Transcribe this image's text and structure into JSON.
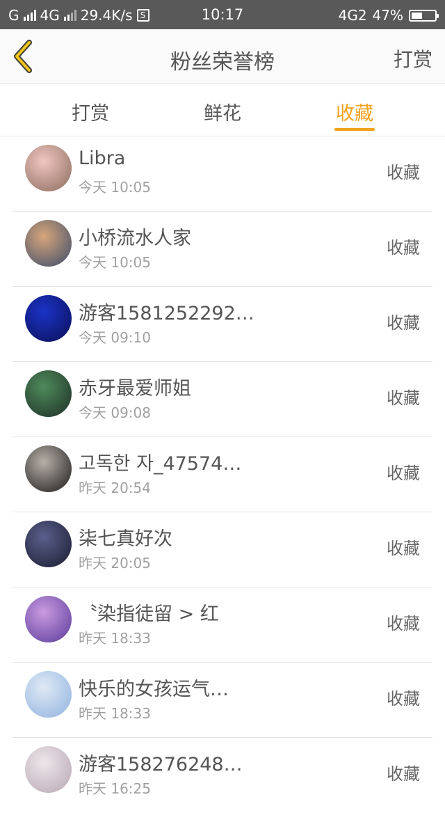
{
  "status_bar": {
    "carrier1": "G",
    "carrier2": "4G",
    "speed": "29.4K/s",
    "s_icon": "S",
    "time": "10:17",
    "network": "4G2",
    "battery": "47%",
    "battery_level": 0.47
  },
  "header": {
    "title": "粉丝荣誉榜",
    "action": "打赏",
    "back_icon": "chevron-left-icon"
  },
  "tabs": [
    {
      "label": "打赏",
      "active": false
    },
    {
      "label": "鲜花",
      "active": false
    },
    {
      "label": "收藏",
      "active": true
    }
  ],
  "accent_color": "#f2a21d",
  "fans": [
    {
      "name": "Libra",
      "time": "今天 10:05",
      "type": "收藏",
      "avatar_colors": [
        "#f1c6c2",
        "#8a6b5a"
      ]
    },
    {
      "name": "小桥流水人家",
      "time": "今天 10:05",
      "type": "收藏",
      "avatar_colors": [
        "#d7a57a",
        "#3a4c6b"
      ]
    },
    {
      "name": "游客1581252292…",
      "time": "今天 09:10",
      "type": "收藏",
      "avatar_colors": [
        "#1c33c8",
        "#0a0f55"
      ]
    },
    {
      "name": "赤牙最爱师姐",
      "time": "今天 09:08",
      "type": "收藏",
      "avatar_colors": [
        "#4f8a5a",
        "#1d2e26"
      ]
    },
    {
      "name": "고독한 자_47574…",
      "time": "昨天 20:54",
      "type": "收藏",
      "avatar_colors": [
        "#b8b0a8",
        "#1b1919"
      ]
    },
    {
      "name": "柒七真好次",
      "time": "昨天 20:05",
      "type": "收藏",
      "avatar_colors": [
        "#5a5f8c",
        "#1a1c2e"
      ]
    },
    {
      "name": "〝染指徒留 > 红",
      "time": "昨天 18:33",
      "type": "收藏",
      "avatar_colors": [
        "#c99be0",
        "#5a3a9a"
      ]
    },
    {
      "name": "快乐的女孩运气…",
      "time": "昨天 18:33",
      "type": "收藏",
      "avatar_colors": [
        "#dfe9f5",
        "#8fb2de"
      ]
    },
    {
      "name": "游客158276248…",
      "time": "昨天 16:25",
      "type": "收藏",
      "avatar_colors": [
        "#ece6ea",
        "#b9a7b3"
      ]
    }
  ]
}
